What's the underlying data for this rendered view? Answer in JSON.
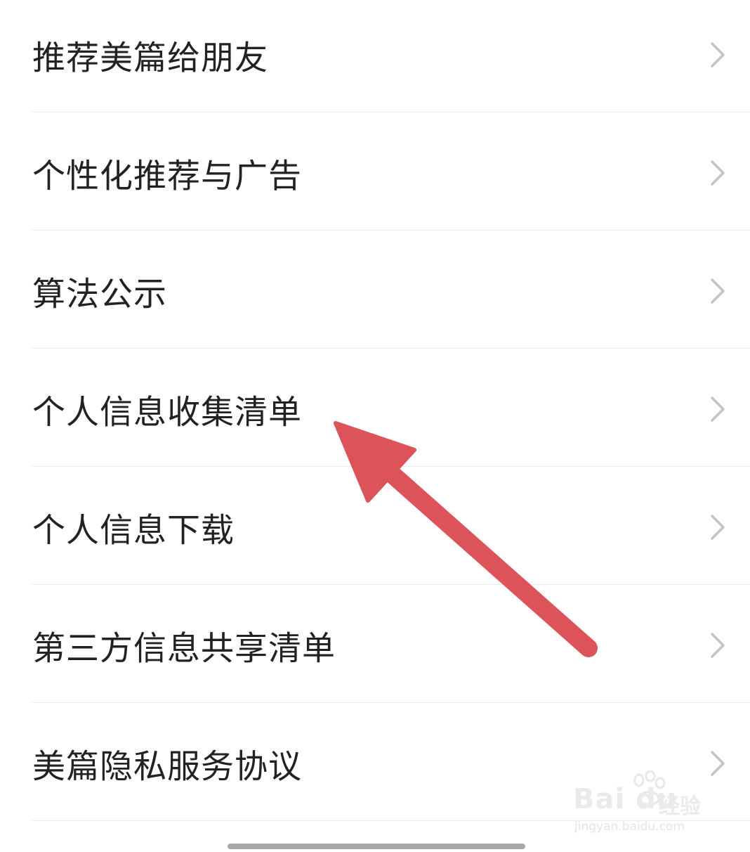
{
  "menu": {
    "items": [
      {
        "label": "推荐美篇给朋友"
      },
      {
        "label": "个性化推荐与广告"
      },
      {
        "label": "算法公示"
      },
      {
        "label": "个人信息收集清单"
      },
      {
        "label": "个人信息下载"
      },
      {
        "label": "第三方信息共享清单"
      },
      {
        "label": "美篇隐私服务协议"
      }
    ]
  },
  "icons": {
    "row_chevron": "chevron-right-icon",
    "annotation": "red-arrow-pointer",
    "watermark_logo": "baidu-paw-icon"
  },
  "watermark": {
    "brand": "Bai du",
    "jingyan": "经验",
    "url": "jingyan.baidu.com"
  },
  "colors": {
    "text": "#222222",
    "chevron": "#c4c4c4",
    "divider": "#ececec",
    "arrow": "#dc545a",
    "home_indicator": "#a8a8a8"
  }
}
